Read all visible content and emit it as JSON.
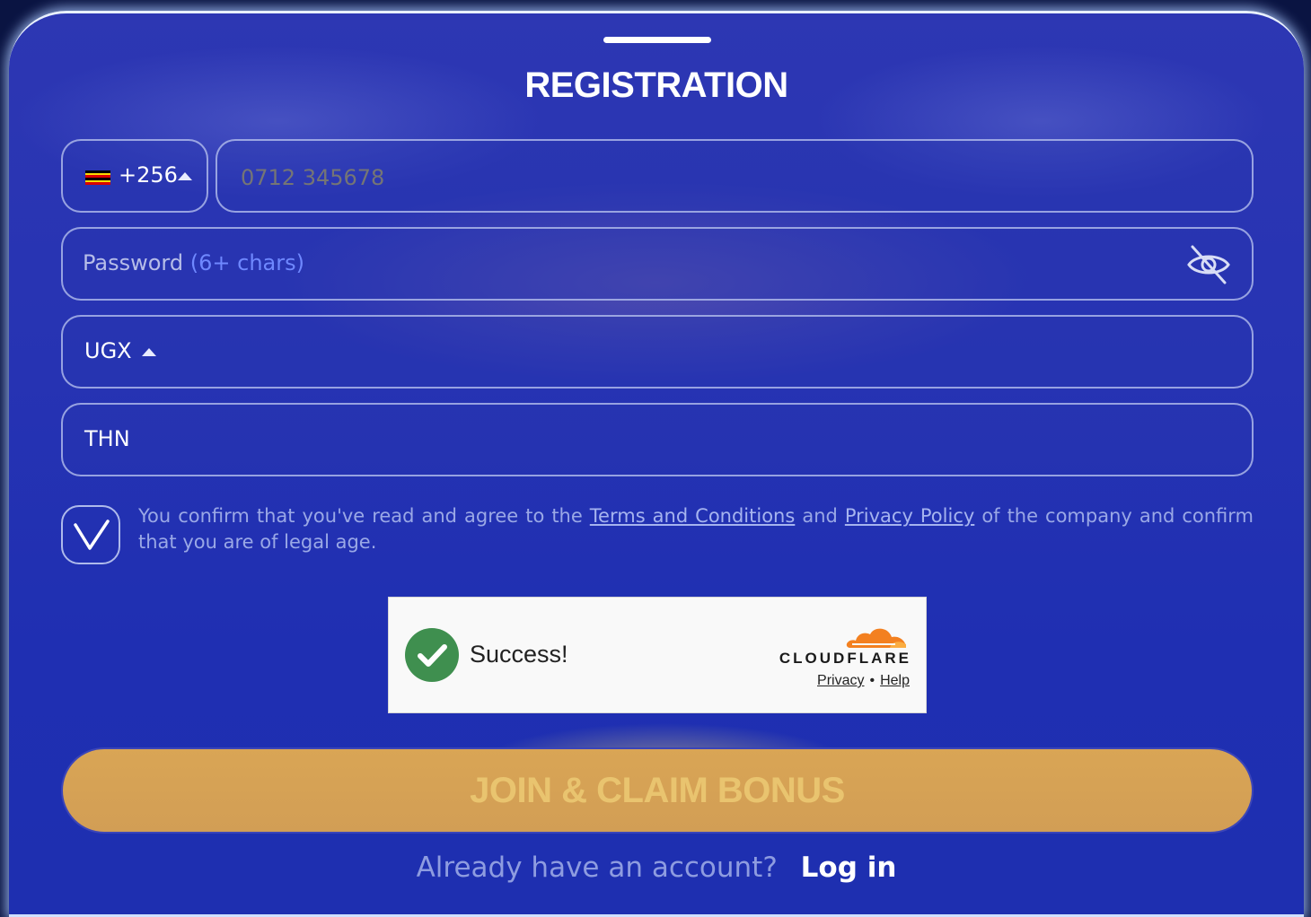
{
  "title": "REGISTRATION",
  "phone": {
    "country_code": "+256",
    "flag": "uganda-flag",
    "placeholder": "0712 345678"
  },
  "password": {
    "label": "Password",
    "hint": "(6+ chars)",
    "toggle_icon": "eye-off-icon"
  },
  "currency": {
    "value": "UGX"
  },
  "promo": {
    "value": "THN"
  },
  "terms": {
    "text_1": "You confirm that you've read and agree to the",
    "terms_link": "Terms and Conditions",
    "text_2": "and",
    "privacy_link": "Privacy Policy",
    "text_3": "of the company and confirm that you are of legal age.",
    "checked": true
  },
  "captcha": {
    "status": "Success!",
    "brand": "CLOUDFLARE",
    "privacy_link": "Privacy",
    "separator": "•",
    "help_link": "Help"
  },
  "join_button_label": "JOIN & CLAIM BONUS",
  "footer": {
    "question": "Already have an account?",
    "login_link": "Log in"
  },
  "colors": {
    "panel": "#2633b3",
    "button": "#d4a157",
    "button_text": "#e9c46f",
    "success_green": "#3f8f4f",
    "cloudflare_orange": "#f38020"
  }
}
